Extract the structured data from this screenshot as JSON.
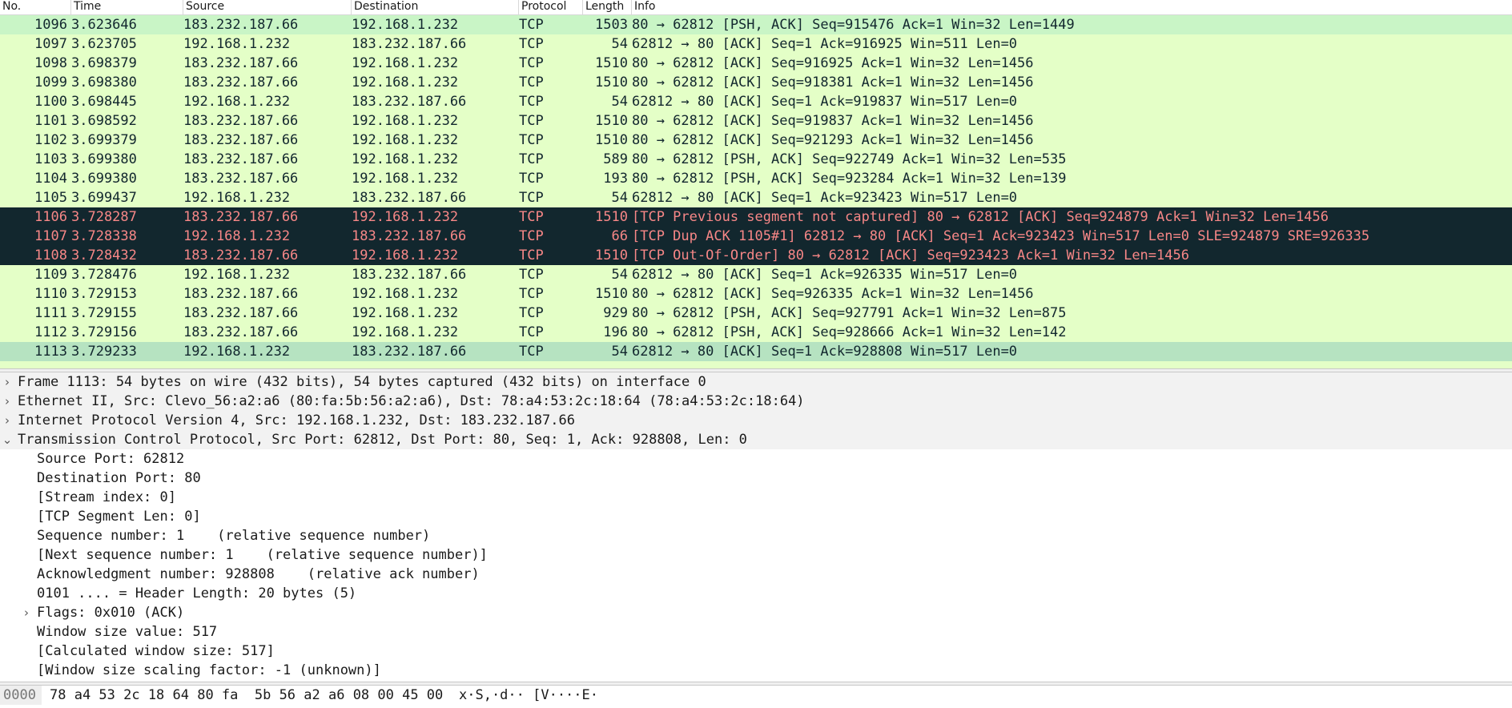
{
  "packet_list": {
    "columns": {
      "no": "No.",
      "time": "Time",
      "source": "Source",
      "destination": "Destination",
      "protocol": "Protocol",
      "length": "Length",
      "info": "Info"
    },
    "rows": [
      {
        "no": "1096",
        "time": "3.623646",
        "src": "183.232.187.66",
        "dst": "192.168.1.232",
        "proto": "TCP",
        "len": "1503",
        "info": "80 → 62812 [PSH, ACK] Seq=915476 Ack=1 Win=32 Len=1449"
      },
      {
        "no": "1097",
        "time": "3.623705",
        "src": "192.168.1.232",
        "dst": "183.232.187.66",
        "proto": "TCP",
        "len": "54",
        "info": "62812 → 80 [ACK] Seq=1 Ack=916925 Win=511 Len=0"
      },
      {
        "no": "1098",
        "time": "3.698379",
        "src": "183.232.187.66",
        "dst": "192.168.1.232",
        "proto": "TCP",
        "len": "1510",
        "info": "80 → 62812 [ACK] Seq=916925 Ack=1 Win=32 Len=1456"
      },
      {
        "no": "1099",
        "time": "3.698380",
        "src": "183.232.187.66",
        "dst": "192.168.1.232",
        "proto": "TCP",
        "len": "1510",
        "info": "80 → 62812 [ACK] Seq=918381 Ack=1 Win=32 Len=1456"
      },
      {
        "no": "1100",
        "time": "3.698445",
        "src": "192.168.1.232",
        "dst": "183.232.187.66",
        "proto": "TCP",
        "len": "54",
        "info": "62812 → 80 [ACK] Seq=1 Ack=919837 Win=517 Len=0"
      },
      {
        "no": "1101",
        "time": "3.698592",
        "src": "183.232.187.66",
        "dst": "192.168.1.232",
        "proto": "TCP",
        "len": "1510",
        "info": "80 → 62812 [ACK] Seq=919837 Ack=1 Win=32 Len=1456"
      },
      {
        "no": "1102",
        "time": "3.699379",
        "src": "183.232.187.66",
        "dst": "192.168.1.232",
        "proto": "TCP",
        "len": "1510",
        "info": "80 → 62812 [ACK] Seq=921293 Ack=1 Win=32 Len=1456"
      },
      {
        "no": "1103",
        "time": "3.699380",
        "src": "183.232.187.66",
        "dst": "192.168.1.232",
        "proto": "TCP",
        "len": "589",
        "info": "80 → 62812 [PSH, ACK] Seq=922749 Ack=1 Win=32 Len=535"
      },
      {
        "no": "1104",
        "time": "3.699380",
        "src": "183.232.187.66",
        "dst": "192.168.1.232",
        "proto": "TCP",
        "len": "193",
        "info": "80 → 62812 [PSH, ACK] Seq=923284 Ack=1 Win=32 Len=139"
      },
      {
        "no": "1105",
        "time": "3.699437",
        "src": "192.168.1.232",
        "dst": "183.232.187.66",
        "proto": "TCP",
        "len": "54",
        "info": "62812 → 80 [ACK] Seq=1 Ack=923423 Win=517 Len=0"
      },
      {
        "no": "1106",
        "time": "3.728287",
        "src": "183.232.187.66",
        "dst": "192.168.1.232",
        "proto": "TCP",
        "len": "1510",
        "info": "[TCP Previous segment not captured] 80 → 62812 [ACK] Seq=924879 Ack=1 Win=32 Len=1456"
      },
      {
        "no": "1107",
        "time": "3.728338",
        "src": "192.168.1.232",
        "dst": "183.232.187.66",
        "proto": "TCP",
        "len": "66",
        "info": "[TCP Dup ACK 1105#1] 62812 → 80 [ACK] Seq=1 Ack=923423 Win=517 Len=0 SLE=924879 SRE=926335"
      },
      {
        "no": "1108",
        "time": "3.728432",
        "src": "183.232.187.66",
        "dst": "192.168.1.232",
        "proto": "TCP",
        "len": "1510",
        "info": "[TCP Out-Of-Order] 80 → 62812 [ACK] Seq=923423 Ack=1 Win=32 Len=1456"
      },
      {
        "no": "1109",
        "time": "3.728476",
        "src": "192.168.1.232",
        "dst": "183.232.187.66",
        "proto": "TCP",
        "len": "54",
        "info": "62812 → 80 [ACK] Seq=1 Ack=926335 Win=517 Len=0"
      },
      {
        "no": "1110",
        "time": "3.729153",
        "src": "183.232.187.66",
        "dst": "192.168.1.232",
        "proto": "TCP",
        "len": "1510",
        "info": "80 → 62812 [ACK] Seq=926335 Ack=1 Win=32 Len=1456"
      },
      {
        "no": "1111",
        "time": "3.729155",
        "src": "183.232.187.66",
        "dst": "192.168.1.232",
        "proto": "TCP",
        "len": "929",
        "info": "80 → 62812 [PSH, ACK] Seq=927791 Ack=1 Win=32 Len=875"
      },
      {
        "no": "1112",
        "time": "3.729156",
        "src": "183.232.187.66",
        "dst": "192.168.1.232",
        "proto": "TCP",
        "len": "196",
        "info": "80 → 62812 [PSH, ACK] Seq=928666 Ack=1 Win=32 Len=142"
      },
      {
        "no": "1113",
        "time": "3.729233",
        "src": "192.168.1.232",
        "dst": "183.232.187.66",
        "proto": "TCP",
        "len": "54",
        "info": "62812 → 80 [ACK] Seq=1 Ack=928808 Win=517 Len=0"
      }
    ]
  },
  "details": {
    "frame": "Frame 1113: 54 bytes on wire (432 bits), 54 bytes captured (432 bits) on interface 0",
    "ethernet": "Ethernet II, Src: Clevo_56:a2:a6 (80:fa:5b:56:a2:a6), Dst: 78:a4:53:2c:18:64 (78:a4:53:2c:18:64)",
    "ip": "Internet Protocol Version 4, Src: 192.168.1.232, Dst: 183.232.187.66",
    "tcp": "Transmission Control Protocol, Src Port: 62812, Dst Port: 80, Seq: 1, Ack: 928808, Len: 0",
    "tcp_fields": {
      "src_port": "Source Port: 62812",
      "dst_port": "Destination Port: 80",
      "stream_index": "[Stream index: 0]",
      "segment_len": "[TCP Segment Len: 0]",
      "seq": "Sequence number: 1    (relative sequence number)",
      "next_seq": "[Next sequence number: 1    (relative sequence number)]",
      "ack": "Acknowledgment number: 928808    (relative ack number)",
      "header_len": "0101 .... = Header Length: 20 bytes (5)",
      "flags": "Flags: 0x010 (ACK)",
      "window": "Window size value: 517",
      "calc_window": "[Calculated window size: 517]",
      "scaling": "[Window size scaling factor: -1 (unknown)]"
    }
  },
  "bytes": {
    "offset": "0000",
    "hex": "78 a4 53 2c 18 64 80 fa  5b 56 a2 a6 08 00 45 00",
    "ascii": "x·S,·d·· [V····E·"
  },
  "icons": {
    "collapsed": "chevron-right-icon",
    "expanded": "chevron-down-icon"
  },
  "colors": {
    "tcp_row_bg": "#e4ffc7",
    "selected_row_bg": "#b6e3c1",
    "bad_tcp_bg": "#12272e",
    "bad_tcp_fg": "#f78787"
  }
}
